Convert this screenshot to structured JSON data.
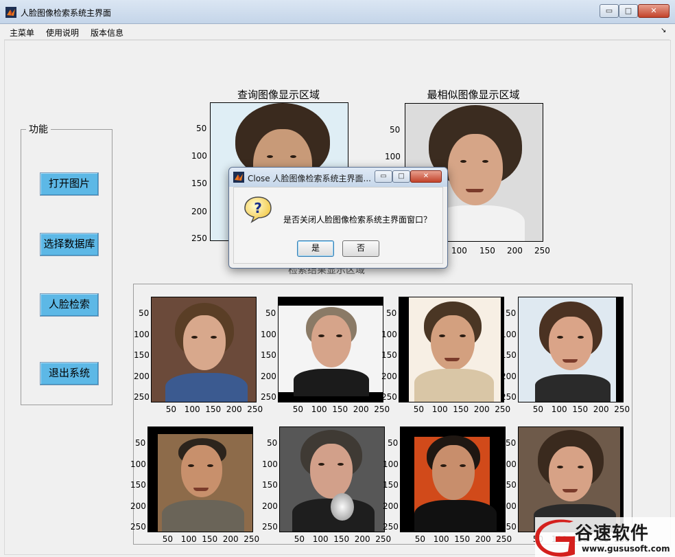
{
  "window": {
    "title": "人脸图像检索系统主界面",
    "controls": {
      "minimize": "▭",
      "maximize": "□",
      "close": "✕"
    }
  },
  "menubar": {
    "items": [
      "主菜单",
      "使用说明",
      "版本信息"
    ],
    "overflow_icon": "arrow-icon"
  },
  "function_panel": {
    "title": "功能",
    "buttons": [
      "打开图片",
      "选择数据库",
      "人脸检索",
      "退出系统"
    ]
  },
  "query_axes": {
    "title": "查询图像显示区域",
    "y_ticks": [
      "50",
      "100",
      "150",
      "200",
      "250"
    ]
  },
  "similar_axes": {
    "title": "最相似图像显示区域",
    "y_ticks": [
      "50",
      "100",
      "150",
      "200",
      "250"
    ],
    "x_ticks": [
      "100",
      "150",
      "200",
      "250"
    ]
  },
  "results_panel": {
    "title": "检索结果显示区域",
    "y_ticks": [
      "50",
      "100",
      "150",
      "200",
      "250"
    ],
    "x_ticks": [
      "50",
      "100",
      "150",
      "200",
      "250"
    ]
  },
  "dialog": {
    "title": "Close 人脸图像检索系统主界面...",
    "message": "是否关闭人脸图像检索系统主界面窗口？",
    "icon": "question-icon",
    "yes_label": "是",
    "no_label": "否",
    "controls": {
      "minimize": "▭",
      "maximize": "□",
      "close": "✕"
    }
  },
  "watermark": {
    "text": "谷速软件",
    "url": "www.gususoft.com"
  },
  "colors": {
    "button_blue": "#5db8e6",
    "window_bg": "#f0f0f0",
    "close_red": "#c2432b"
  }
}
